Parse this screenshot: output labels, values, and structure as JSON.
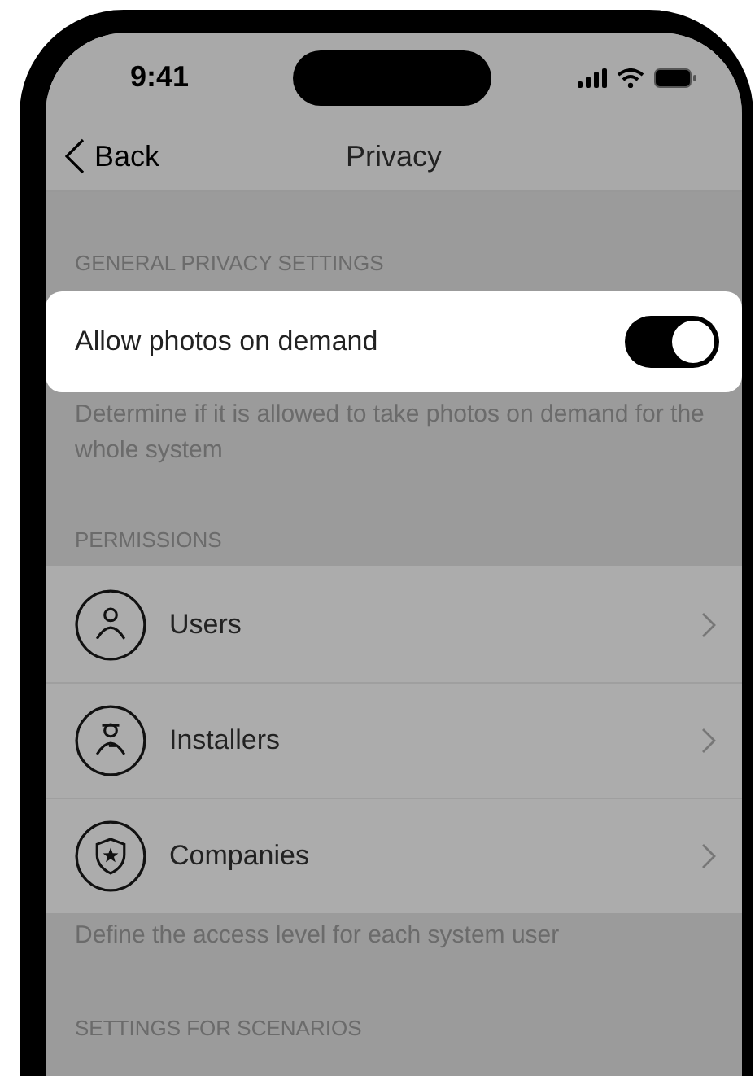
{
  "status_bar": {
    "time": "9:41"
  },
  "nav": {
    "back": "Back",
    "title": "Privacy"
  },
  "sections": [
    {
      "header": "GENERAL PRIVACY SETTINGS",
      "rows": [
        {
          "kind": "toggle",
          "label": "Allow photos on demand",
          "on": true,
          "highlighted": true
        }
      ],
      "footer": "Determine if it is allowed to take photos on demand for the whole system"
    },
    {
      "header": "PERMISSIONS",
      "rows": [
        {
          "kind": "link",
          "label": "Users",
          "highlighted": false
        },
        {
          "kind": "link",
          "label": "Installers",
          "highlighted": false
        },
        {
          "kind": "link",
          "label": "Companies",
          "highlighted": false
        }
      ],
      "footer": "Define the access level for each system user"
    },
    {
      "header": "SETTINGS FOR SCENARIOS"
    }
  ]
}
